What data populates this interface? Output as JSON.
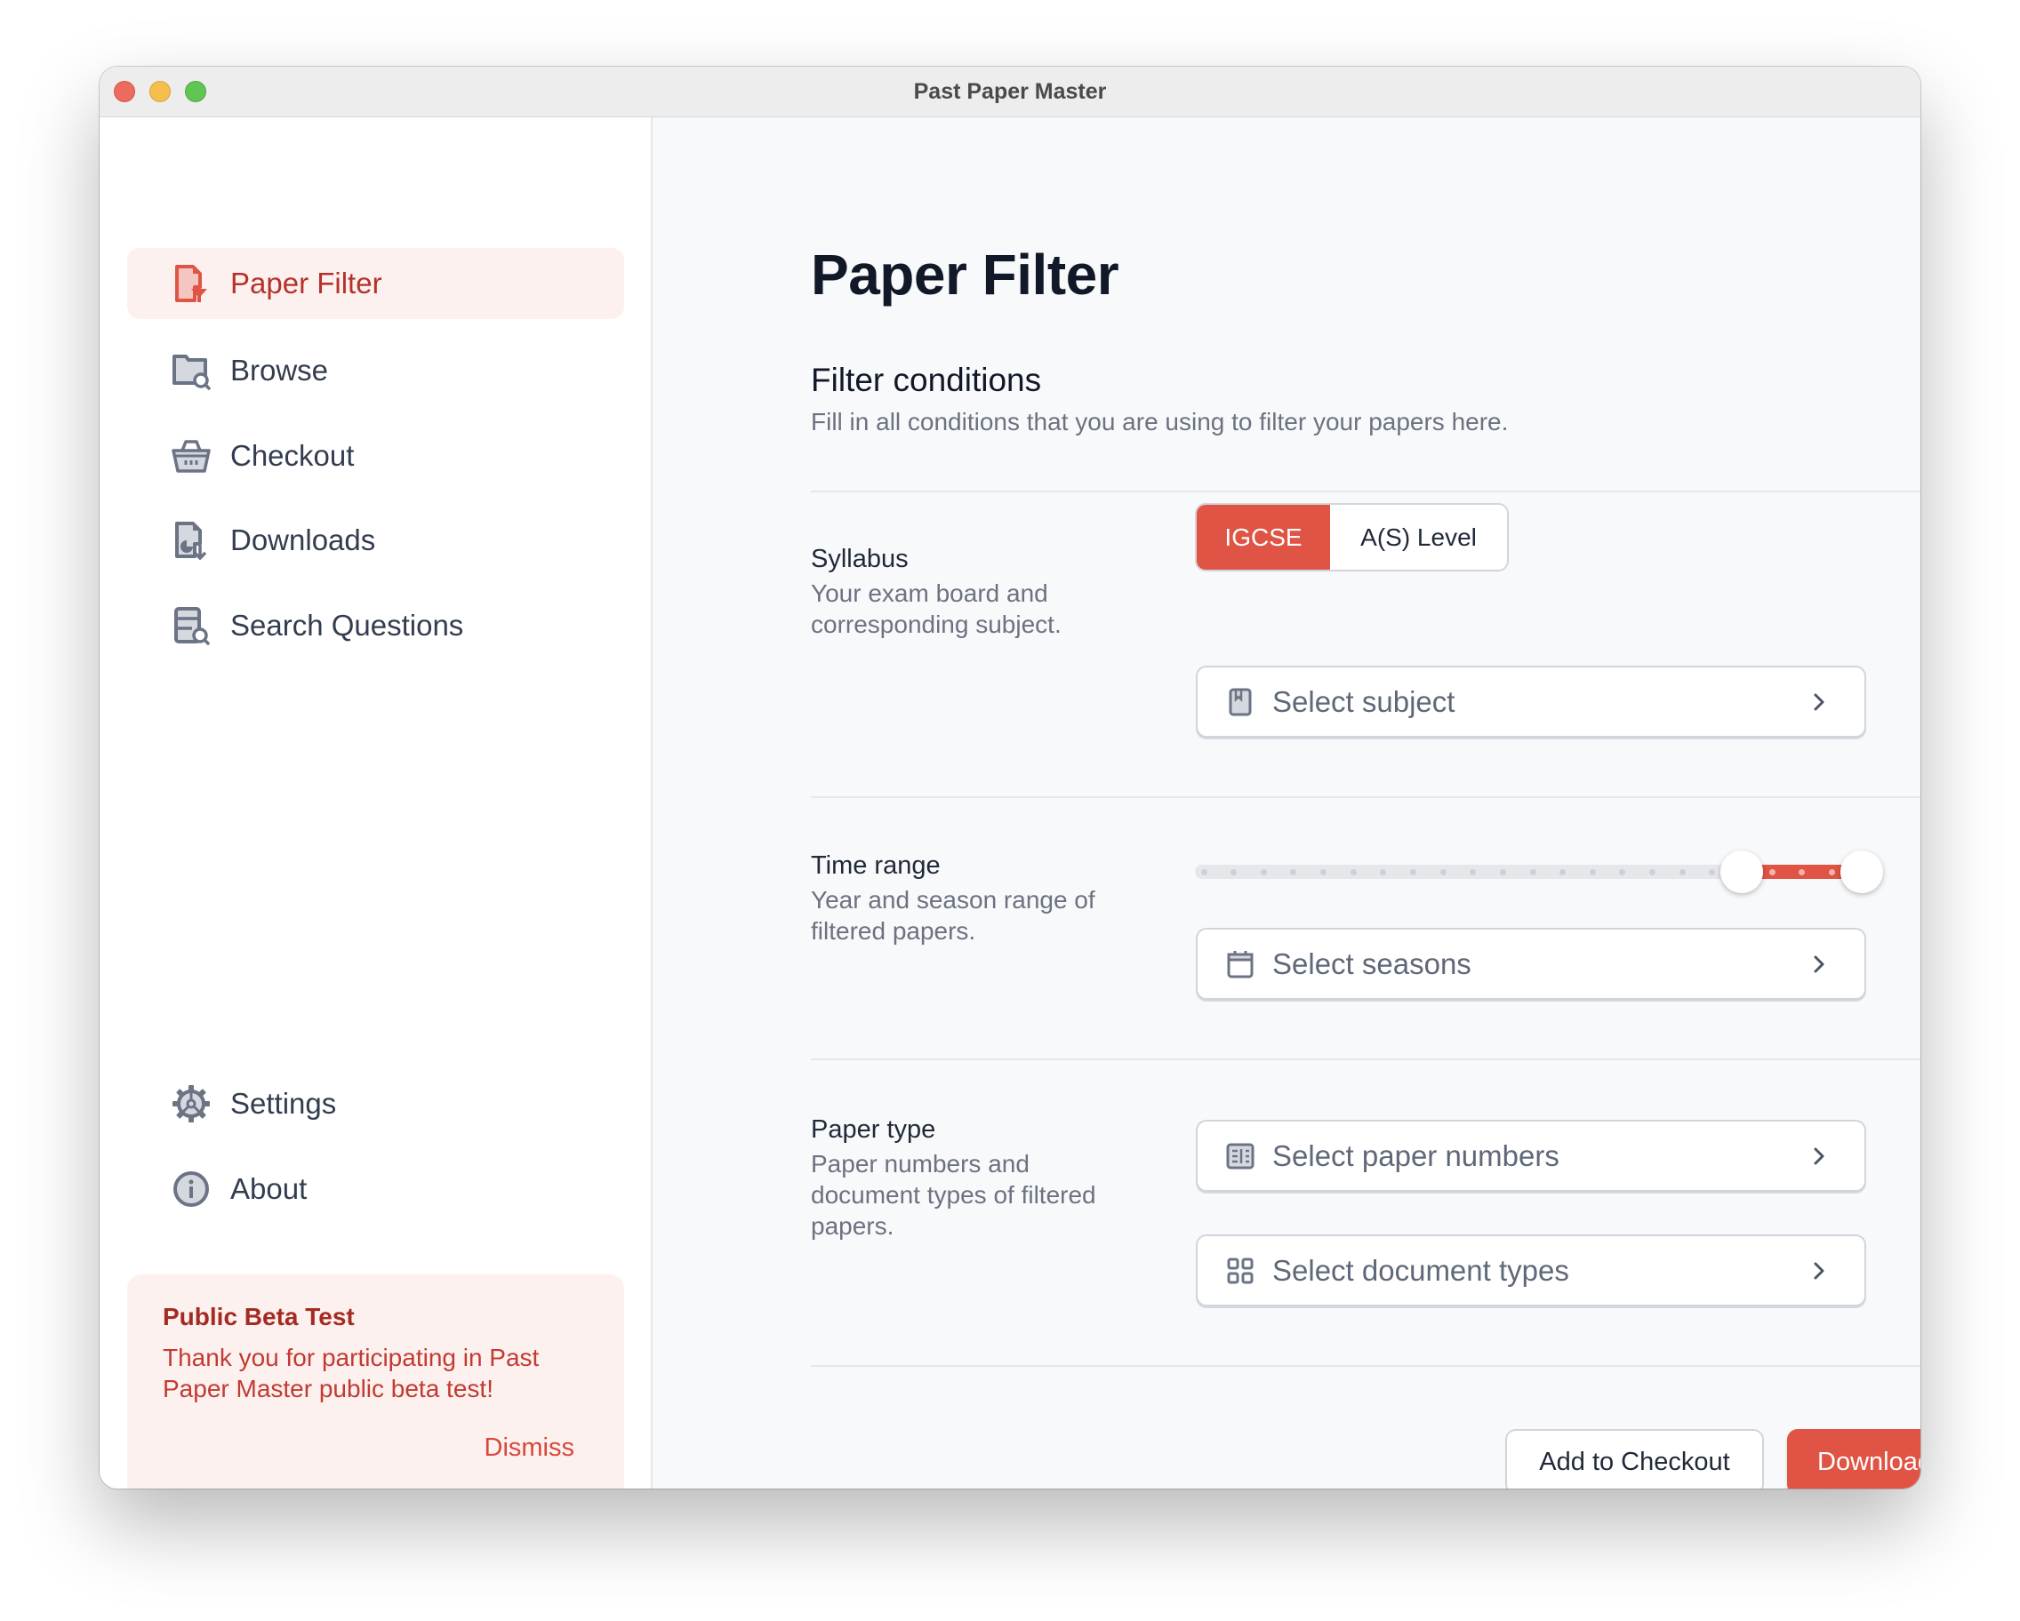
{
  "window": {
    "title": "Past Paper Master",
    "controls": [
      "close",
      "minimize",
      "maximize"
    ]
  },
  "sidebar": {
    "items": [
      {
        "label": "Paper Filter",
        "icon": "document-filter-icon",
        "active": true
      },
      {
        "label": "Browse",
        "icon": "folder-search-icon",
        "active": false
      },
      {
        "label": "Checkout",
        "icon": "basket-icon",
        "active": false
      },
      {
        "label": "Downloads",
        "icon": "document-download-icon",
        "active": false
      },
      {
        "label": "Search Questions",
        "icon": "list-search-icon",
        "active": false
      }
    ],
    "bottom_items": [
      {
        "label": "Settings",
        "icon": "gear-icon"
      },
      {
        "label": "About",
        "icon": "info-icon"
      }
    ],
    "beta_card": {
      "title": "Public Beta Test",
      "text": "Thank you for participating in Past Paper Master public beta test!",
      "dismiss_label": "Dismiss"
    }
  },
  "main": {
    "page_title": "Paper Filter",
    "section_title": "Filter conditions",
    "section_desc": "Fill in all conditions that you are using to filter your papers here.",
    "groups": {
      "syllabus": {
        "title": "Syllabus",
        "desc": "Your exam board and corresponding subject.",
        "options": [
          "IGCSE",
          "A(S) Level"
        ],
        "selected": "IGCSE",
        "select_subject": {
          "placeholder": "Select subject",
          "icon": "book-icon"
        }
      },
      "time_range": {
        "title": "Time range",
        "desc": "Year and season range of filtered papers.",
        "slider": {
          "steps": 23,
          "low_index": 18,
          "high_index": 22
        },
        "select_seasons": {
          "placeholder": "Select seasons",
          "icon": "calendar-icon"
        }
      },
      "paper_type": {
        "title": "Paper type",
        "desc": "Paper numbers and document types of filtered papers.",
        "select_numbers": {
          "placeholder": "Select paper numbers",
          "icon": "number-grid-icon"
        },
        "select_types": {
          "placeholder": "Select document types",
          "icon": "grid-icon"
        }
      }
    },
    "actions": {
      "add_to_checkout": "Add to Checkout",
      "download": "Download"
    }
  },
  "colors": {
    "accent": "#df5444",
    "accent_dark": "#b4322a",
    "active_bg": "#fdf1f0",
    "text_primary": "#111827",
    "text_muted": "#6b7280"
  }
}
